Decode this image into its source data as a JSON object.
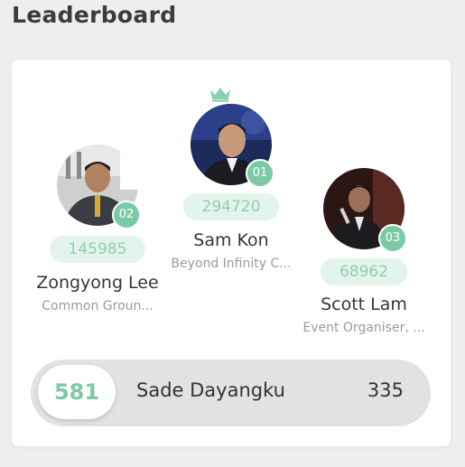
{
  "page_title": "Leaderboard",
  "colors": {
    "accent": "#7cc9a5",
    "accent_light": "#e3f4ec",
    "crown": "#8ccfae"
  },
  "podium": [
    {
      "rank_label": "01",
      "score": "294720",
      "name": "Sam Kon",
      "org": "Beyond Infinity C..."
    },
    {
      "rank_label": "02",
      "score": "145985",
      "name": "Zongyong Lee",
      "org": "Common Groun..."
    },
    {
      "rank_label": "03",
      "score": "68962",
      "name": "Scott Lam",
      "org": "Event Organiser, ..."
    }
  ],
  "current_user": {
    "rank": "581",
    "name": "Sade Dayangku",
    "score": "335"
  },
  "icons": {
    "crown": "crown-icon"
  }
}
